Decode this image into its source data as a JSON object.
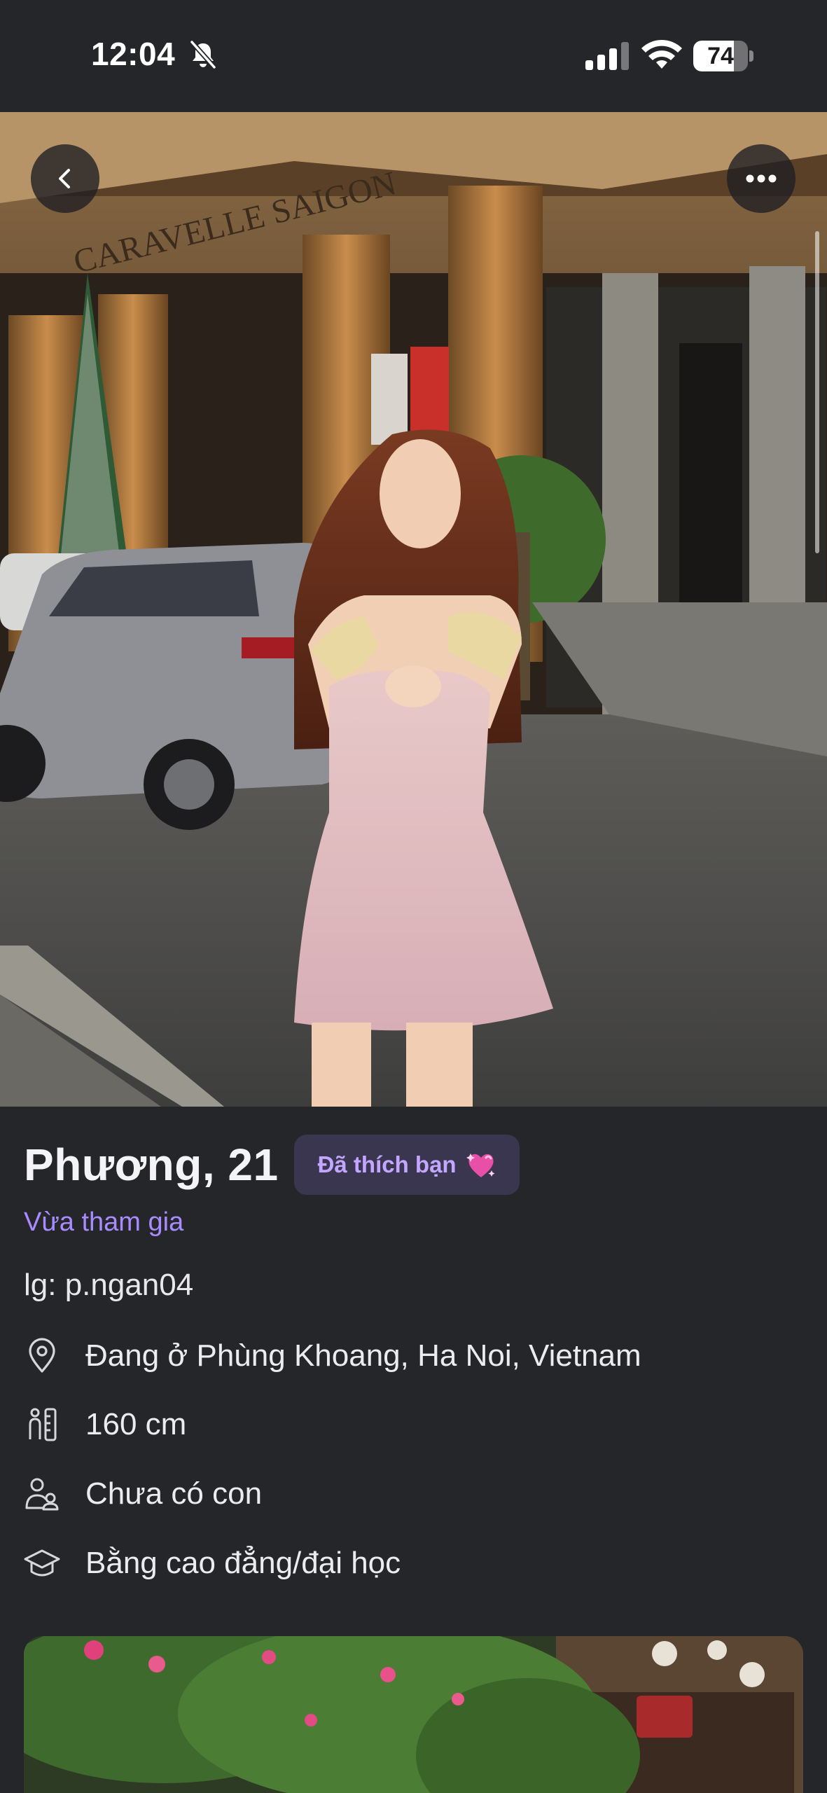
{
  "status_bar": {
    "time": "12:04",
    "battery_level": "74",
    "battery_fraction": 0.74,
    "icons": [
      "bell-slash-icon",
      "cellular-signal-icon",
      "wifi-icon",
      "battery-icon"
    ]
  },
  "hero_photo": {
    "storefront_sign": "CARAVELLE SAIGON"
  },
  "nav": {
    "back_icon": "chevron-left-icon",
    "more_icon": "ellipsis-icon"
  },
  "profile": {
    "name_age": "Phương, 21",
    "liked_badge": "Đã thích bạn",
    "liked_icon": "sparkling-heart-icon",
    "status": "Vừa tham gia",
    "instagram": "lg: p.ngan04",
    "details": [
      {
        "icon": "location-pin-icon",
        "text": "Đang ở Phùng Khoang, Ha Noi, Vietnam"
      },
      {
        "icon": "height-icon",
        "text": "160 cm"
      },
      {
        "icon": "children-icon",
        "text": "Chưa có con"
      },
      {
        "icon": "graduation-cap-icon",
        "text": "Bằng cao đẳng/đại học"
      }
    ]
  },
  "colors": {
    "background": "#25262a",
    "accent": "#a98bff",
    "badge_bg": "#3b3650",
    "badge_text": "#c3a6ff"
  }
}
